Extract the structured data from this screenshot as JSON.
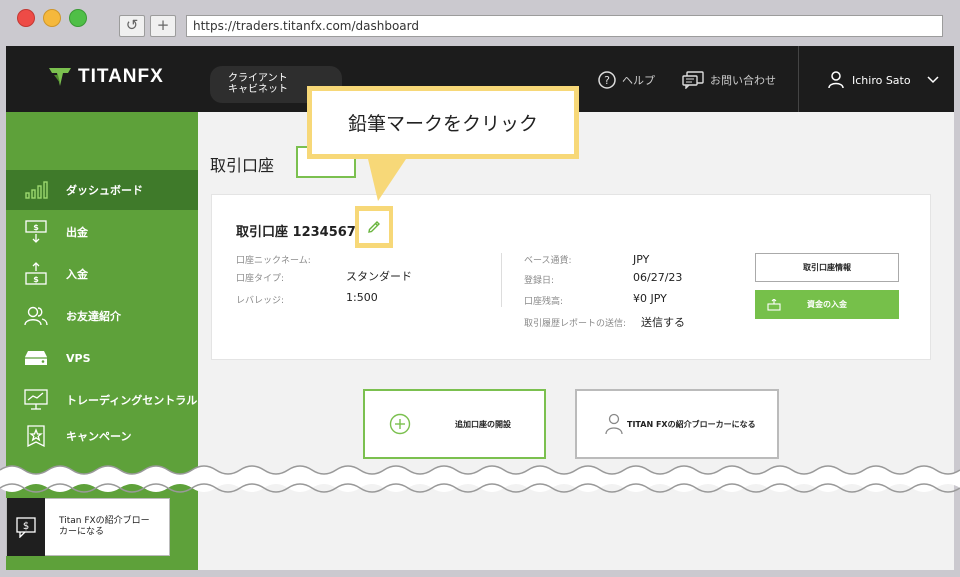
{
  "browser": {
    "url": "https://traders.titanfx.com/dashboard",
    "reload_icon": "reload-icon",
    "new_tab_icon": "plus-icon"
  },
  "header": {
    "logo_text": "TITANFX",
    "cabinet_label_line1": "クライアント",
    "cabinet_label_line2": "キャビネット",
    "help_label": "ヘルプ",
    "contact_label": "お問い合わせ",
    "user_name": "Ichiro Sato"
  },
  "sidebar": {
    "items": [
      {
        "label": "ダッシュボード",
        "icon": "chart-bars-icon",
        "active": true
      },
      {
        "label": "出金",
        "icon": "withdraw-icon",
        "active": false
      },
      {
        "label": "入金",
        "icon": "deposit-icon",
        "active": false
      },
      {
        "label": "お友達紹介",
        "icon": "friends-icon",
        "active": false
      },
      {
        "label": "VPS",
        "icon": "server-icon",
        "active": false
      },
      {
        "label": "トレーディングセントラル",
        "icon": "monitor-chart-icon",
        "active": false
      },
      {
        "label": "キャンペーン",
        "icon": "star-badge-icon",
        "active": false
      }
    ],
    "bottom_card": {
      "line1": "Titan FXの紹介ブロー",
      "line2": "カーになる"
    }
  },
  "main": {
    "section_title": "取引口座",
    "account_card": {
      "title": "取引口座 1234567",
      "left_fields": [
        {
          "label": "口座ニックネーム:",
          "value": ""
        },
        {
          "label": "口座タイプ:",
          "value": "スタンダード"
        },
        {
          "label": "レバレッジ:",
          "value": "1:500"
        }
      ],
      "right_fields": [
        {
          "label": "ベース通貨:",
          "value": "JPY"
        },
        {
          "label": "登録日:",
          "value": "06/27/23"
        },
        {
          "label": "口座残高:",
          "value": "¥0 JPY"
        },
        {
          "label": "取引履歴レポートの送信:",
          "value": "送信する"
        }
      ],
      "info_button": "取引口座情報",
      "deposit_button": "資金の入金"
    },
    "add_account_tile": "追加口座の開設",
    "ib_tile": "TITAN FXの紹介ブローカーになる"
  },
  "callout": {
    "text": "鉛筆マークをクリック"
  },
  "colors": {
    "brand_green": "#5ea13a",
    "accent_green": "#76c04a",
    "callout_yellow": "#f7d878",
    "topbar": "#1c1c1c"
  }
}
